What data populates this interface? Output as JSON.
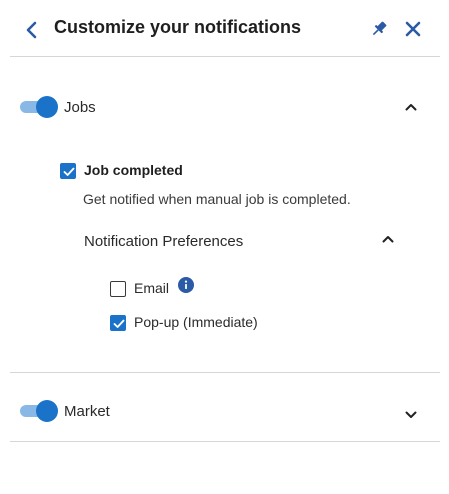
{
  "header": {
    "title": "Customize your notifications"
  },
  "sections": [
    {
      "label": "Jobs",
      "enabled": true,
      "expanded": true,
      "items": [
        {
          "title": "Job completed",
          "checked": true,
          "description": "Get notified when manual job is completed.",
          "preferences": {
            "label": "Notification Preferences",
            "expanded": true,
            "options": [
              {
                "label": "Email",
                "checked": false,
                "icon": "info-icon"
              },
              {
                "label": "Pop-up (Immediate)",
                "checked": true
              }
            ]
          }
        }
      ]
    },
    {
      "label": "Market",
      "enabled": true,
      "expanded": false
    }
  ],
  "colors": {
    "accent": "#1a73c8",
    "toggle_track": "#8ab8e6",
    "header_icons": "#2b5aa6",
    "divider": "#d6d6d6"
  }
}
